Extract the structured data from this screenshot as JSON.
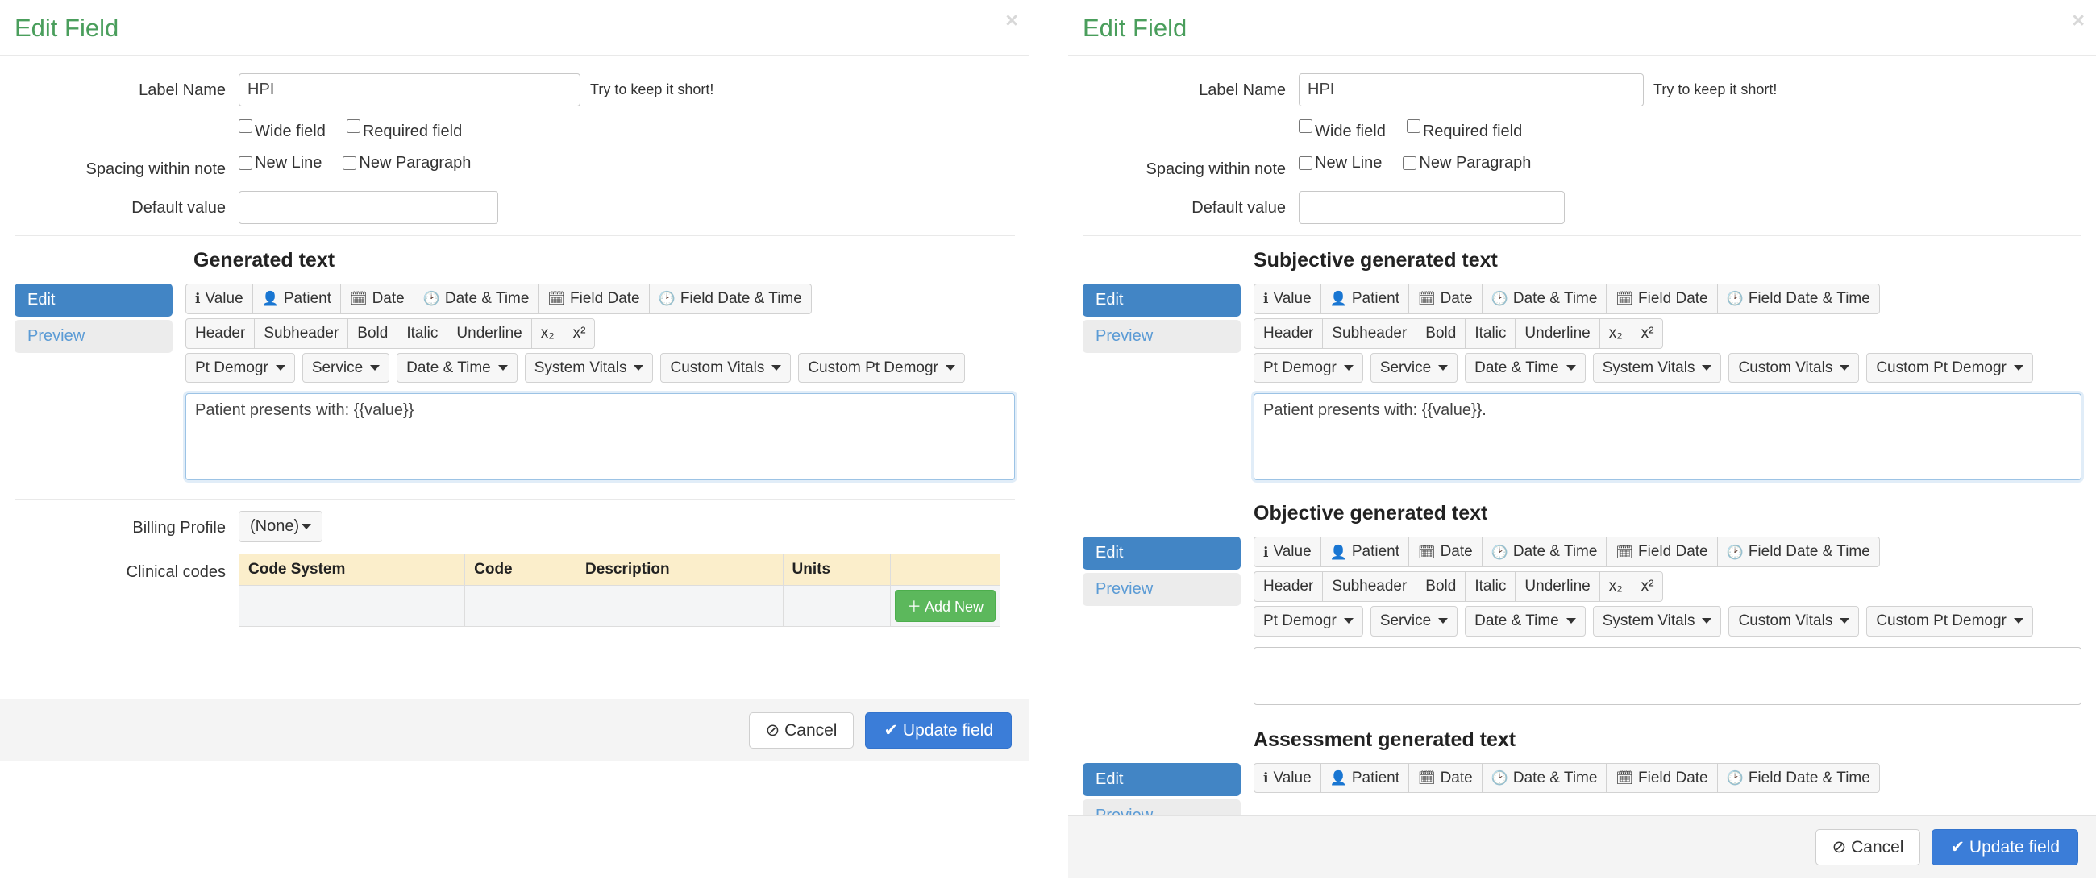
{
  "left": {
    "title": "Edit Field",
    "close_icon": "close-icon",
    "close_glyph": "×",
    "label_name": {
      "label": "Label Name",
      "value": "HPI",
      "hint": "Try to keep it short!"
    },
    "checkboxes": {
      "wide_field": "Wide field",
      "required_field": "Required field"
    },
    "spacing": {
      "label": "Spacing within note",
      "new_line": "New Line",
      "new_paragraph": "New Paragraph"
    },
    "default_value": {
      "label": "Default value",
      "value": ""
    },
    "generated": {
      "heading": "Generated text",
      "tabs": [
        {
          "label": "Edit",
          "active": true
        },
        {
          "label": "Preview",
          "active": false
        }
      ],
      "toolbar_row1": [
        {
          "label": "Value",
          "icon": "info-icon",
          "glyph": "ℹ"
        },
        {
          "label": "Patient",
          "icon": "user-icon",
          "glyph": "👤"
        },
        {
          "label": "Date",
          "icon": "calendar-icon",
          "glyph": "🗓"
        },
        {
          "label": "Date & Time",
          "icon": "clock-icon",
          "glyph": "🕑"
        },
        {
          "label": "Field Date",
          "icon": "calendar-icon",
          "glyph": "🗓"
        },
        {
          "label": "Field Date & Time",
          "icon": "clock-icon",
          "glyph": "🕑"
        }
      ],
      "toolbar_row2": [
        {
          "label": "Header"
        },
        {
          "label": "Subheader"
        },
        {
          "label": "Bold"
        },
        {
          "label": "Italic"
        },
        {
          "label": "Underline"
        },
        {
          "label": "x₂"
        },
        {
          "label": "x²"
        }
      ],
      "toolbar_row3": [
        {
          "label": "Pt Demogr"
        },
        {
          "label": "Service"
        },
        {
          "label": "Date & Time"
        },
        {
          "label": "System Vitals"
        },
        {
          "label": "Custom Vitals"
        },
        {
          "label": "Custom Pt Demogr"
        }
      ],
      "textarea_value": "Patient presents with: {{value}}"
    },
    "billing": {
      "label": "Billing Profile",
      "selected": "(None)"
    },
    "clinical_codes": {
      "label": "Clinical codes",
      "columns": [
        "Code System",
        "Code",
        "Description",
        "Units",
        ""
      ],
      "rows": [],
      "add_button": "Add New",
      "add_icon_glyph": "＋"
    },
    "footer": {
      "cancel": "Cancel",
      "cancel_icon_glyph": "⊘",
      "update": "Update field",
      "update_icon_glyph": "✔"
    }
  },
  "right": {
    "title": "Edit Field",
    "close_glyph": "×",
    "label_name": {
      "label": "Label Name",
      "value": "HPI",
      "hint": "Try to keep it short!"
    },
    "checkboxes": {
      "wide_field": "Wide field",
      "required_field": "Required field"
    },
    "spacing": {
      "label": "Spacing within note",
      "new_line": "New Line",
      "new_paragraph": "New Paragraph"
    },
    "default_value": {
      "label": "Default value",
      "value": ""
    },
    "sections": [
      {
        "heading": "Subjective generated text",
        "tabs": [
          {
            "label": "Edit",
            "active": true
          },
          {
            "label": "Preview",
            "active": false
          }
        ],
        "textarea_value": "Patient presents with: {{value}}.",
        "focused": true
      },
      {
        "heading": "Objective generated text",
        "tabs": [
          {
            "label": "Edit",
            "active": true
          },
          {
            "label": "Preview",
            "active": false
          }
        ],
        "textarea_value": "",
        "focused": false
      },
      {
        "heading": "Assessment generated text",
        "tabs": [
          {
            "label": "Edit",
            "active": true
          },
          {
            "label": "Preview",
            "active": false
          }
        ],
        "textarea_value": "",
        "focused": false
      }
    ],
    "toolbar_row1": [
      {
        "label": "Value",
        "icon": "info-icon",
        "glyph": "ℹ"
      },
      {
        "label": "Patient",
        "icon": "user-icon",
        "glyph": "👤"
      },
      {
        "label": "Date",
        "icon": "calendar-icon",
        "glyph": "🗓"
      },
      {
        "label": "Date & Time",
        "icon": "clock-icon",
        "glyph": "🕑"
      },
      {
        "label": "Field Date",
        "icon": "calendar-icon",
        "glyph": "🗓"
      },
      {
        "label": "Field Date & Time",
        "icon": "clock-icon",
        "glyph": "🕑"
      }
    ],
    "toolbar_row2": [
      {
        "label": "Header"
      },
      {
        "label": "Subheader"
      },
      {
        "label": "Bold"
      },
      {
        "label": "Italic"
      },
      {
        "label": "Underline"
      },
      {
        "label": "x₂"
      },
      {
        "label": "x²"
      }
    ],
    "toolbar_row3": [
      {
        "label": "Pt Demogr"
      },
      {
        "label": "Service"
      },
      {
        "label": "Date & Time"
      },
      {
        "label": "System Vitals"
      },
      {
        "label": "Custom Vitals"
      },
      {
        "label": "Custom Pt Demogr"
      }
    ],
    "footer": {
      "cancel": "Cancel",
      "cancel_icon_glyph": "⊘",
      "update": "Update field",
      "update_icon_glyph": "✔"
    }
  },
  "colors": {
    "title_green": "#4a9e5c",
    "primary_blue": "#3b7dd8",
    "tab_active_blue": "#4285c5",
    "tab_inactive_text": "#5b9bd5",
    "add_new_green": "#5cb85c",
    "table_header_cream": "#fbeecb"
  }
}
